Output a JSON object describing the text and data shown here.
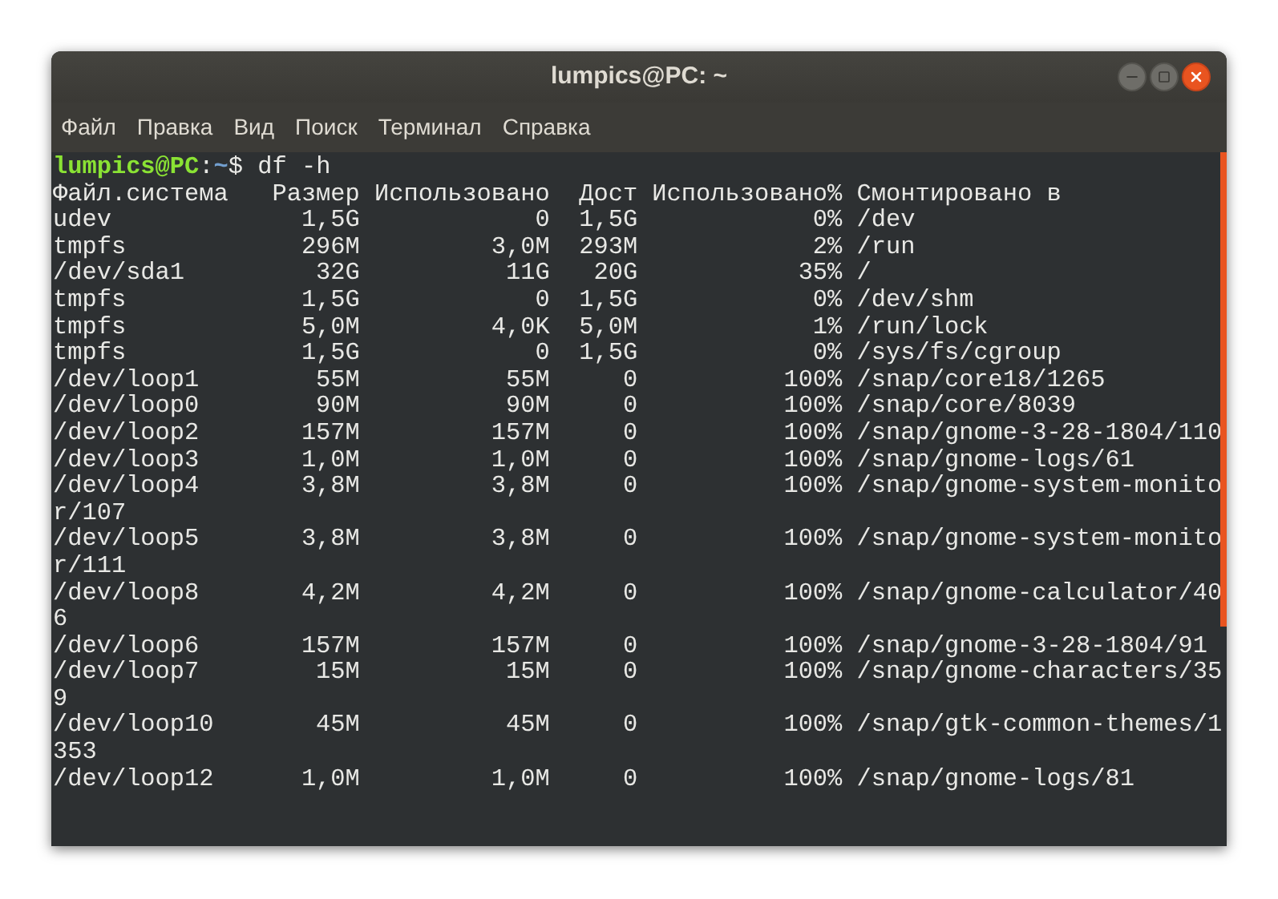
{
  "window": {
    "title": "lumpics@PC: ~"
  },
  "menu": [
    {
      "label": "Файл"
    },
    {
      "label": "Правка"
    },
    {
      "label": "Вид"
    },
    {
      "label": "Поиск"
    },
    {
      "label": "Терминал"
    },
    {
      "label": "Справка"
    }
  ],
  "terminal": {
    "prompt": {
      "user_host": "lumpics@PC",
      "separator": ":",
      "path": "~",
      "symbol": "$",
      "command": "df -h"
    },
    "header": {
      "filesystem": "Файл.система",
      "size": "Размер",
      "used": "Использовано",
      "avail": "Дост",
      "use_pct": "Использовано%",
      "mounted_on": "Смонтировано в"
    },
    "rows": [
      {
        "filesystem": "udev",
        "size": "1,5G",
        "used": "0",
        "avail": "1,5G",
        "use_pct": "0%",
        "mounted_on": "/dev"
      },
      {
        "filesystem": "tmpfs",
        "size": "296M",
        "used": "3,0M",
        "avail": "293M",
        "use_pct": "2%",
        "mounted_on": "/run"
      },
      {
        "filesystem": "/dev/sda1",
        "size": "32G",
        "used": "11G",
        "avail": "20G",
        "use_pct": "35%",
        "mounted_on": "/"
      },
      {
        "filesystem": "tmpfs",
        "size": "1,5G",
        "used": "0",
        "avail": "1,5G",
        "use_pct": "0%",
        "mounted_on": "/dev/shm"
      },
      {
        "filesystem": "tmpfs",
        "size": "5,0M",
        "used": "4,0K",
        "avail": "5,0M",
        "use_pct": "1%",
        "mounted_on": "/run/lock"
      },
      {
        "filesystem": "tmpfs",
        "size": "1,5G",
        "used": "0",
        "avail": "1,5G",
        "use_pct": "0%",
        "mounted_on": "/sys/fs/cgroup"
      },
      {
        "filesystem": "/dev/loop1",
        "size": "55M",
        "used": "55M",
        "avail": "0",
        "use_pct": "100%",
        "mounted_on": "/snap/core18/1265"
      },
      {
        "filesystem": "/dev/loop0",
        "size": "90M",
        "used": "90M",
        "avail": "0",
        "use_pct": "100%",
        "mounted_on": "/snap/core/8039"
      },
      {
        "filesystem": "/dev/loop2",
        "size": "157M",
        "used": "157M",
        "avail": "0",
        "use_pct": "100%",
        "mounted_on": "/snap/gnome-3-28-1804/110"
      },
      {
        "filesystem": "/dev/loop3",
        "size": "1,0M",
        "used": "1,0M",
        "avail": "0",
        "use_pct": "100%",
        "mounted_on": "/snap/gnome-logs/61"
      },
      {
        "filesystem": "/dev/loop4",
        "size": "3,8M",
        "used": "3,8M",
        "avail": "0",
        "use_pct": "100%",
        "mounted_on": "/snap/gnome-system-monitor/107"
      },
      {
        "filesystem": "/dev/loop5",
        "size": "3,8M",
        "used": "3,8M",
        "avail": "0",
        "use_pct": "100%",
        "mounted_on": "/snap/gnome-system-monitor/111"
      },
      {
        "filesystem": "/dev/loop8",
        "size": "4,2M",
        "used": "4,2M",
        "avail": "0",
        "use_pct": "100%",
        "mounted_on": "/snap/gnome-calculator/406"
      },
      {
        "filesystem": "/dev/loop6",
        "size": "157M",
        "used": "157M",
        "avail": "0",
        "use_pct": "100%",
        "mounted_on": "/snap/gnome-3-28-1804/91"
      },
      {
        "filesystem": "/dev/loop7",
        "size": "15M",
        "used": "15M",
        "avail": "0",
        "use_pct": "100%",
        "mounted_on": "/snap/gnome-characters/359"
      },
      {
        "filesystem": "/dev/loop10",
        "size": "45M",
        "used": "45M",
        "avail": "0",
        "use_pct": "100%",
        "mounted_on": "/snap/gtk-common-themes/1353"
      },
      {
        "filesystem": "/dev/loop12",
        "size": "1,0M",
        "used": "1,0M",
        "avail": "0",
        "use_pct": "100%",
        "mounted_on": "/snap/gnome-logs/81"
      }
    ]
  }
}
